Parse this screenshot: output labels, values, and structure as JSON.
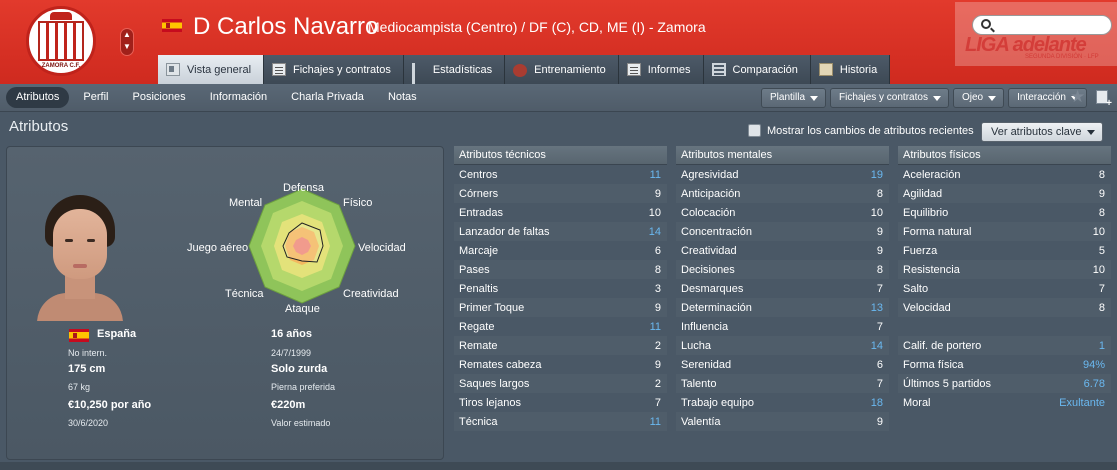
{
  "header": {
    "player_name": "D Carlos Navarro",
    "position": "Mediocampista (Centro) / DF (C), CD, ME (I) - Zamora",
    "club_badge_text": "ZAMORA C.F.",
    "league_logo_text": "LIGA adelante",
    "league_logo_sub": "SEGUNDA DIVISIÓN · LFP",
    "search_placeholder": ""
  },
  "tabs": [
    {
      "label": "Vista general",
      "icon": "card-icon"
    },
    {
      "label": "Fichajes y contratos",
      "icon": "document-icon"
    },
    {
      "label": "Estadísticas",
      "icon": "bar-chart-icon"
    },
    {
      "label": "Entrenamiento",
      "icon": "ball-icon"
    },
    {
      "label": "Informes",
      "icon": "report-icon"
    },
    {
      "label": "Comparación",
      "icon": "compare-icon"
    },
    {
      "label": "Historia",
      "icon": "history-icon"
    }
  ],
  "subnav": [
    "Atributos",
    "Perfil",
    "Posiciones",
    "Información",
    "Charla Privada",
    "Notas"
  ],
  "toolbar": [
    "Plantilla",
    "Fichajes y contratos",
    "Ojeo",
    "Interacción"
  ],
  "section_title": "Atributos",
  "show_changes_label": "Mostrar los cambios de atributos recientes",
  "key_attributes_button": "Ver atributos clave",
  "radar_labels": {
    "top": "Defensa",
    "top_right": "Físico",
    "right": "Velocidad",
    "bottom_right": "Creatividad",
    "bottom": "Ataque",
    "bottom_left": "Técnica",
    "left": "Juego aéreo",
    "top_left": "Mental"
  },
  "bio": {
    "nationality": "España",
    "intl": "No intern.",
    "age": "16 años",
    "dob": "24/7/1999",
    "height": "175 cm",
    "foot": "Solo zurda",
    "weight": "67 kg",
    "foot_label": "Pierna preferida",
    "wage": "€10,250 por año",
    "value": "€220m",
    "contract_end": "30/6/2020",
    "value_label": "Valor estimado"
  },
  "technical": {
    "title": "Atributos técnicos",
    "rows": [
      [
        "Centros",
        "11"
      ],
      [
        "Córners",
        "9"
      ],
      [
        "Entradas",
        "10"
      ],
      [
        "Lanzador de faltas",
        "14"
      ],
      [
        "Marcaje",
        "6"
      ],
      [
        "Pases",
        "8"
      ],
      [
        "Penaltis",
        "3"
      ],
      [
        "Primer Toque",
        "9"
      ],
      [
        "Regate",
        "11"
      ],
      [
        "Remate",
        "2"
      ],
      [
        "Remates cabeza",
        "9"
      ],
      [
        "Saques largos",
        "2"
      ],
      [
        "Tiros lejanos",
        "7"
      ],
      [
        "Técnica",
        "11"
      ]
    ]
  },
  "mental": {
    "title": "Atributos mentales",
    "rows": [
      [
        "Agresividad",
        "19"
      ],
      [
        "Anticipación",
        "8"
      ],
      [
        "Colocación",
        "10"
      ],
      [
        "Concentración",
        "9"
      ],
      [
        "Creatividad",
        "9"
      ],
      [
        "Decisiones",
        "8"
      ],
      [
        "Desmarques",
        "7"
      ],
      [
        "Determinación",
        "13"
      ],
      [
        "Influencia",
        "7"
      ],
      [
        "Lucha",
        "14"
      ],
      [
        "Serenidad",
        "6"
      ],
      [
        "Talento",
        "7"
      ],
      [
        "Trabajo equipo",
        "18"
      ],
      [
        "Valentía",
        "9"
      ]
    ]
  },
  "physical": {
    "title": "Atributos físicos",
    "rows": [
      [
        "Aceleración",
        "8"
      ],
      [
        "Agilidad",
        "9"
      ],
      [
        "Equilibrio",
        "8"
      ],
      [
        "Forma natural",
        "10"
      ],
      [
        "Fuerza",
        "5"
      ],
      [
        "Resistencia",
        "10"
      ],
      [
        "Salto",
        "7"
      ],
      [
        "Velocidad",
        "8"
      ]
    ],
    "extra": [
      [
        "Calif. de portero",
        "1"
      ],
      [
        "Forma física",
        "94%"
      ],
      [
        "Últimos 5 partidos",
        "6.78"
      ],
      [
        "Moral",
        "Exultante"
      ]
    ]
  },
  "colors": {
    "header_red": "#e23a2c",
    "panel": "#4b5864",
    "value_highlight": "#6ab8f0"
  }
}
